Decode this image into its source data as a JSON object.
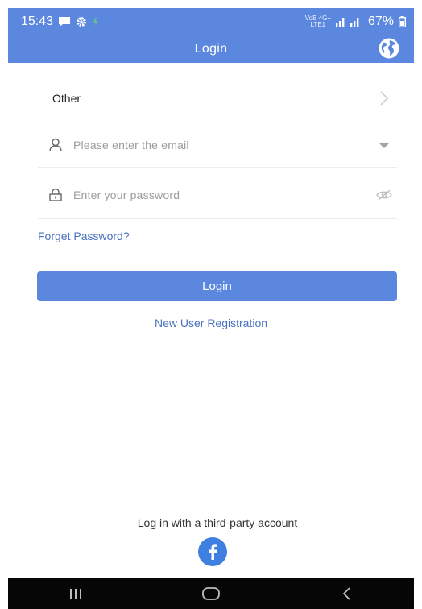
{
  "status_bar": {
    "time": "15:43",
    "network_top": "VoB 4G+",
    "network_bottom": "LTE1",
    "battery": "67%",
    "icons": [
      "message-icon",
      "gear-icon",
      "signal-icon",
      "battery-icon"
    ]
  },
  "app_bar": {
    "title": "Login",
    "globe_icon": "globe-icon"
  },
  "form": {
    "region_label": "Other",
    "email": {
      "placeholder": "Please enter the email",
      "value": ""
    },
    "password": {
      "placeholder": "Enter your password",
      "value": ""
    },
    "forget_password": "Forget Password?",
    "login_button": "Login",
    "register_link": "New User Registration"
  },
  "third_party": {
    "label": "Log in with a third-party account",
    "facebook_icon": "facebook-icon"
  },
  "colors": {
    "primary": "#5b87df",
    "link": "#4a72c2",
    "facebook": "#3f7fe0"
  }
}
